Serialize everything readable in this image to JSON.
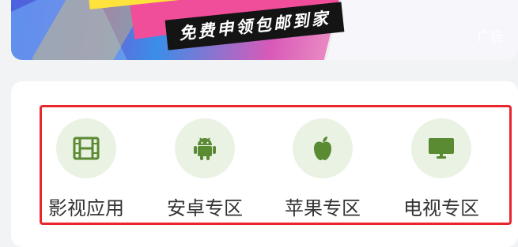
{
  "banner": {
    "headline": "免费申领包邮到家",
    "ad_label": "广告"
  },
  "categories": [
    {
      "label": "影视应用",
      "icon": "film-icon"
    },
    {
      "label": "安卓专区",
      "icon": "android-icon"
    },
    {
      "label": "苹果专区",
      "icon": "apple-icon"
    },
    {
      "label": "电视专区",
      "icon": "tv-icon"
    }
  ],
  "colors": {
    "icon_green": "#5a8a32",
    "icon_circle": "#e9f2e3",
    "highlight_border": "#e8262c"
  }
}
